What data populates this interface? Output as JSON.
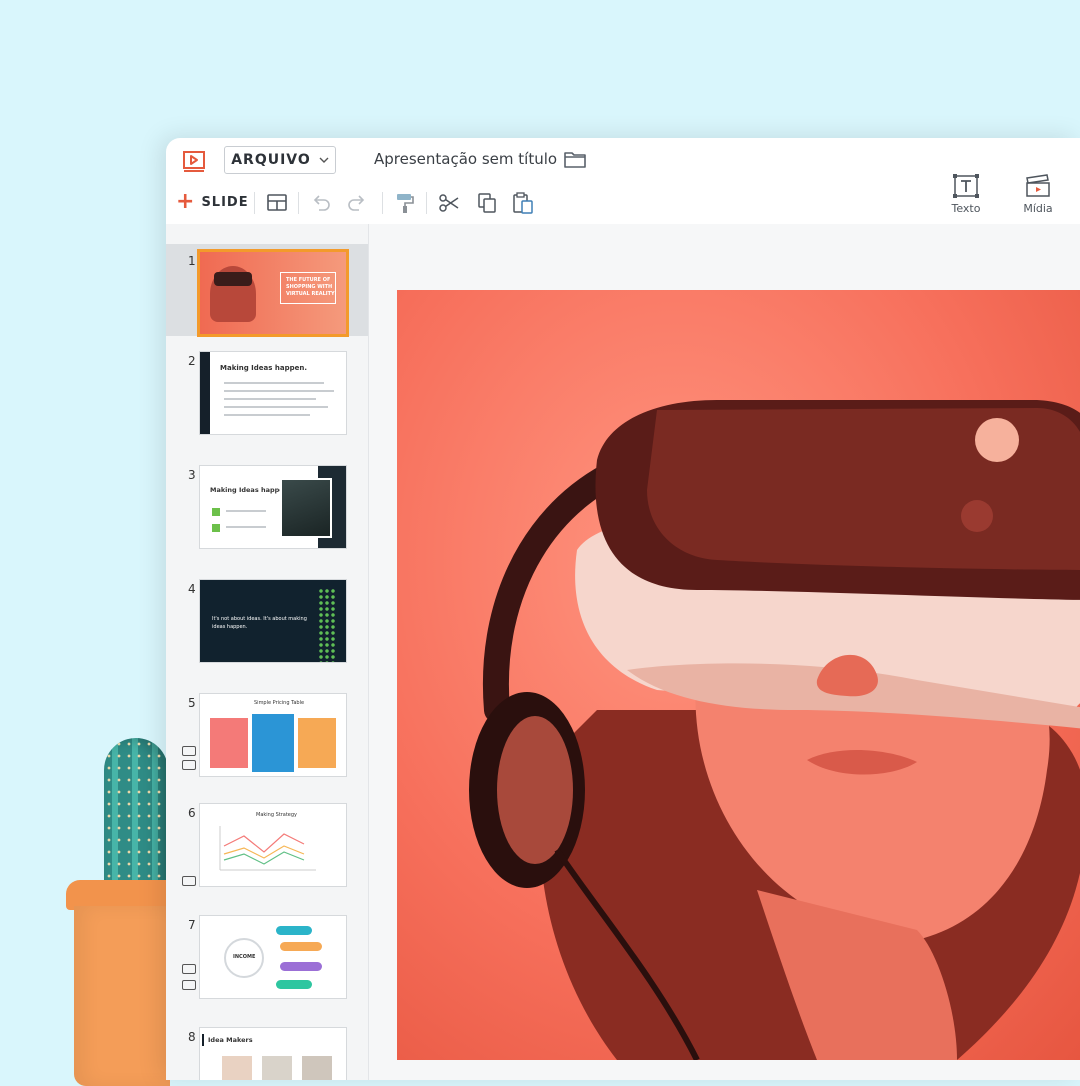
{
  "header": {
    "file_menu_label": "ARQUIVO",
    "document_title": "Apresentação sem título"
  },
  "toolbar": {
    "add_slide_label": "SLIDE",
    "text_tool_label": "Texto",
    "media_tool_label": "Mídia"
  },
  "colors": {
    "accent": "#e55a3d",
    "selection": "#f39a2b",
    "background": "#d9f6fc"
  },
  "slides": [
    {
      "number": "1",
      "text": [
        "THE FUTURE OF",
        "SHOPPING WITH",
        "VIRTUAL REALITY"
      ]
    },
    {
      "number": "2",
      "title": "Making Ideas happen."
    },
    {
      "number": "3",
      "title": "Making Ideas happen"
    },
    {
      "number": "4",
      "text": [
        "It's not about ideas. It's about making",
        "ideas happen."
      ]
    },
    {
      "number": "5",
      "title": "Simple Pricing Table"
    },
    {
      "number": "6",
      "title": "Making Strategy"
    },
    {
      "number": "7",
      "center": "INCOME"
    },
    {
      "number": "8",
      "title": "Idea Makers"
    }
  ]
}
